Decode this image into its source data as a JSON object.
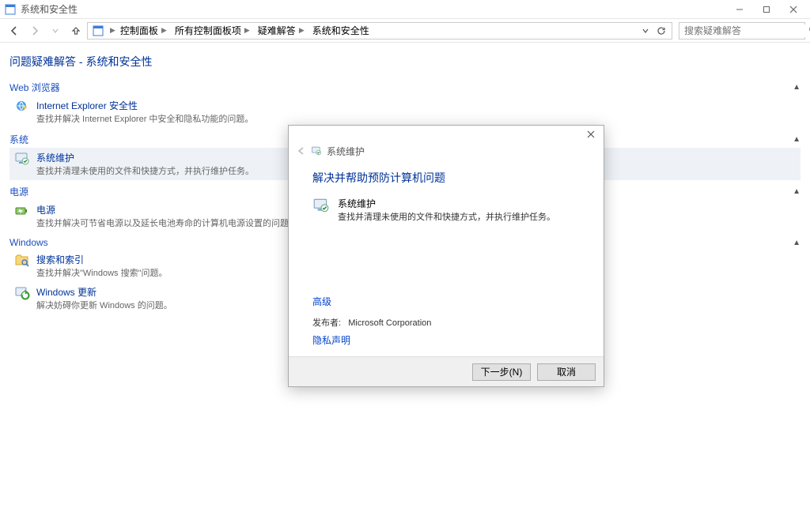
{
  "window": {
    "title": "系统和安全性",
    "minimize": "—",
    "maximize": "☐",
    "close": "✕"
  },
  "nav": {
    "breadcrumbs": [
      "控制面板",
      "所有控制面板项",
      "疑难解答",
      "系统和安全性"
    ]
  },
  "search": {
    "placeholder": "搜索疑难解答"
  },
  "page": {
    "title": "问题疑难解答 - 系统和安全性"
  },
  "sections": [
    {
      "name": "Web 浏览器",
      "items": [
        {
          "label": "Internet Explorer 安全性",
          "desc": "查找并解决 Internet Explorer 中安全和隐私功能的问题。",
          "icon": "ie-shield"
        }
      ]
    },
    {
      "name": "系统",
      "items": [
        {
          "label": "系统维护",
          "desc": "查找并清理未使用的文件和快捷方式，并执行维护任务。",
          "icon": "maintenance",
          "highlight": true
        }
      ]
    },
    {
      "name": "电源",
      "items": [
        {
          "label": "电源",
          "desc": "查找并解决可节省电源以及延长电池寿命的计算机电源设置的问题。",
          "icon": "power"
        }
      ]
    },
    {
      "name": "Windows",
      "items": [
        {
          "label": "搜索和索引",
          "desc": "查找并解决\"Windows 搜索\"问题。",
          "icon": "search-folder"
        },
        {
          "label": "Windows 更新",
          "desc": "解决妨碍你更新 Windows 的问题。",
          "icon": "update"
        }
      ]
    }
  ],
  "modal": {
    "crumb_label": "系统维护",
    "title": "解决并帮助预防计算机问题",
    "item": {
      "label": "系统维护",
      "desc": "查找并清理未使用的文件和快捷方式，并执行维护任务。"
    },
    "advanced": "高级",
    "publisher_label": "发布者:",
    "publisher_value": "Microsoft Corporation",
    "privacy": "隐私声明",
    "next": "下一步(N)",
    "cancel": "取消"
  }
}
